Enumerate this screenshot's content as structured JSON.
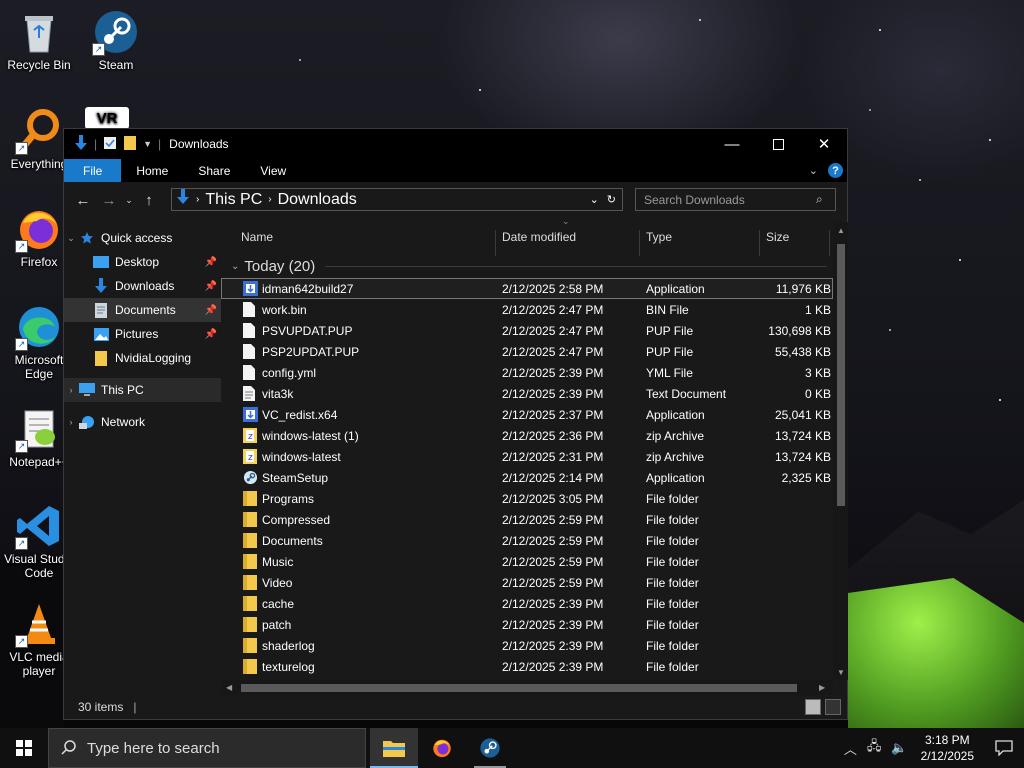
{
  "desktop": {
    "icons": [
      {
        "label": "Recycle Bin"
      },
      {
        "label": "Steam"
      },
      {
        "label": "Everything"
      },
      {
        "label": "VR"
      },
      {
        "label": "Firefox"
      },
      {
        "label": "Microsoft Edge"
      },
      {
        "label": "Notepad++"
      },
      {
        "label": "Visual Studio Code"
      },
      {
        "label": "VLC media player"
      }
    ]
  },
  "window": {
    "title": "Downloads",
    "ribbon_tabs": [
      "File",
      "Home",
      "Share",
      "View"
    ],
    "breadcrumb": [
      "This PC",
      "Downloads"
    ],
    "search_placeholder": "Search Downloads",
    "nav": {
      "quick_access": "Quick access",
      "items": [
        {
          "label": "Desktop",
          "pinned": true
        },
        {
          "label": "Downloads",
          "pinned": true
        },
        {
          "label": "Documents",
          "pinned": true
        },
        {
          "label": "Pictures",
          "pinned": true
        },
        {
          "label": "NvidiaLogging",
          "pinned": false
        }
      ],
      "this_pc": "This PC",
      "network": "Network"
    },
    "columns": {
      "name": "Name",
      "date": "Date modified",
      "type": "Type",
      "size": "Size"
    },
    "group": "Today (20)",
    "files": [
      {
        "name": "idman642build27",
        "date": "2/12/2025 2:58 PM",
        "type": "Application",
        "size": "11,976 KB",
        "icon": "installer-icon"
      },
      {
        "name": "work.bin",
        "date": "2/12/2025 2:47 PM",
        "type": "BIN File",
        "size": "1 KB",
        "icon": "file-icon"
      },
      {
        "name": "PSVUPDAT.PUP",
        "date": "2/12/2025 2:47 PM",
        "type": "PUP File",
        "size": "130,698 KB",
        "icon": "file-icon"
      },
      {
        "name": "PSP2UPDAT.PUP",
        "date": "2/12/2025 2:47 PM",
        "type": "PUP File",
        "size": "55,438 KB",
        "icon": "file-icon"
      },
      {
        "name": "config.yml",
        "date": "2/12/2025 2:39 PM",
        "type": "YML File",
        "size": "3 KB",
        "icon": "file-icon"
      },
      {
        "name": "vita3k",
        "date": "2/12/2025 2:39 PM",
        "type": "Text Document",
        "size": "0 KB",
        "icon": "text-file-icon"
      },
      {
        "name": "VC_redist.x64",
        "date": "2/12/2025 2:37 PM",
        "type": "Application",
        "size": "25,041 KB",
        "icon": "installer-icon"
      },
      {
        "name": "windows-latest (1)",
        "date": "2/12/2025 2:36 PM",
        "type": "zip Archive",
        "size": "13,724 KB",
        "icon": "zip-icon"
      },
      {
        "name": "windows-latest",
        "date": "2/12/2025 2:31 PM",
        "type": "zip Archive",
        "size": "13,724 KB",
        "icon": "zip-icon"
      },
      {
        "name": "SteamSetup",
        "date": "2/12/2025 2:14 PM",
        "type": "Application",
        "size": "2,325 KB",
        "icon": "steam-icon"
      },
      {
        "name": "Programs",
        "date": "2/12/2025 3:05 PM",
        "type": "File folder",
        "size": "",
        "icon": "folder-icon"
      },
      {
        "name": "Compressed",
        "date": "2/12/2025 2:59 PM",
        "type": "File folder",
        "size": "",
        "icon": "folder-icon"
      },
      {
        "name": "Documents",
        "date": "2/12/2025 2:59 PM",
        "type": "File folder",
        "size": "",
        "icon": "folder-icon"
      },
      {
        "name": "Music",
        "date": "2/12/2025 2:59 PM",
        "type": "File folder",
        "size": "",
        "icon": "folder-icon"
      },
      {
        "name": "Video",
        "date": "2/12/2025 2:59 PM",
        "type": "File folder",
        "size": "",
        "icon": "folder-icon"
      },
      {
        "name": "cache",
        "date": "2/12/2025 2:39 PM",
        "type": "File folder",
        "size": "",
        "icon": "folder-icon"
      },
      {
        "name": "patch",
        "date": "2/12/2025 2:39 PM",
        "type": "File folder",
        "size": "",
        "icon": "folder-icon"
      },
      {
        "name": "shaderlog",
        "date": "2/12/2025 2:39 PM",
        "type": "File folder",
        "size": "",
        "icon": "folder-icon"
      },
      {
        "name": "texturelog",
        "date": "2/12/2025 2:39 PM",
        "type": "File folder",
        "size": "",
        "icon": "folder-icon"
      }
    ],
    "status": "30 items"
  },
  "taskbar": {
    "search_placeholder": "Type here to search",
    "time": "3:18 PM",
    "date": "2/12/2025"
  },
  "colors": {
    "accent": "#1979ca",
    "folder": "#f2c94c",
    "window_bg": "#191919",
    "taskbar_bg": "#101010"
  }
}
